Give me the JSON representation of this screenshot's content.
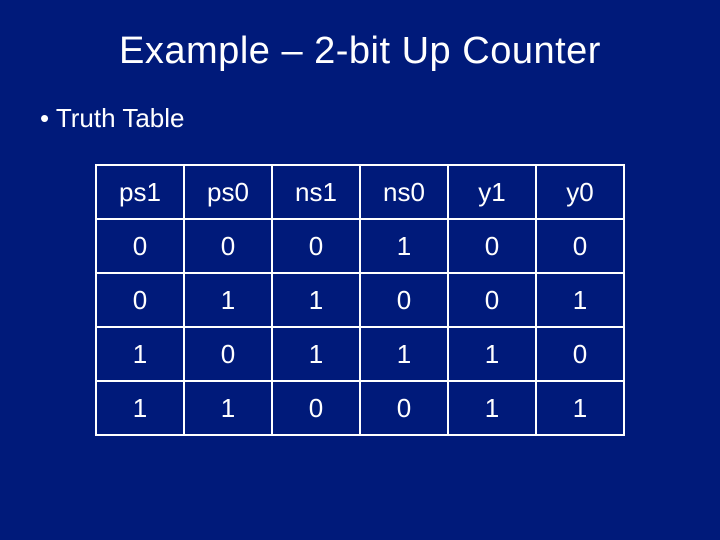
{
  "title": "Example – 2-bit Up Counter",
  "bullet": "Truth Table",
  "chart_data": {
    "type": "table",
    "headers": [
      "ps1",
      "ps0",
      "ns1",
      "ns0",
      "y1",
      "y0"
    ],
    "rows": [
      [
        "0",
        "0",
        "0",
        "1",
        "0",
        "0"
      ],
      [
        "0",
        "1",
        "1",
        "0",
        "0",
        "1"
      ],
      [
        "1",
        "0",
        "1",
        "1",
        "1",
        "0"
      ],
      [
        "1",
        "1",
        "0",
        "0",
        "1",
        "1"
      ]
    ]
  }
}
